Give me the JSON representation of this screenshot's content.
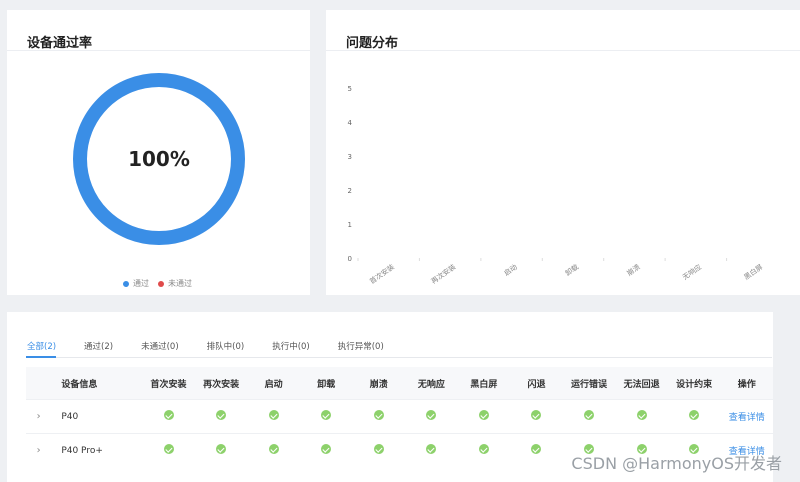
{
  "pass_rate": {
    "title": "设备通过率",
    "center_text": "100%",
    "pass_fraction": 1.0,
    "legend": [
      {
        "label": "通过",
        "color": "#3a8ee6"
      },
      {
        "label": "未通过",
        "color": "#e04b4b"
      }
    ]
  },
  "distribution": {
    "title": "问题分布"
  },
  "chart_data": {
    "type": "bar",
    "categories": [
      "首次安装",
      "再次安装",
      "启动",
      "卸载",
      "崩溃",
      "无响应",
      "黑白屏"
    ],
    "values": [
      0,
      0,
      0,
      0,
      0,
      0,
      0
    ],
    "ylim": [
      0,
      5
    ],
    "yticks": [
      "0",
      "1",
      "2",
      "3",
      "4",
      "5"
    ],
    "title": "",
    "xlabel": "",
    "ylabel": ""
  },
  "tabs": [
    "全部(2)",
    "通过(2)",
    "未通过(0)",
    "排队中(0)",
    "执行中(0)",
    "执行异常(0)"
  ],
  "table": {
    "columns": [
      "设备信息",
      "首次安装",
      "再次安装",
      "启动",
      "卸载",
      "崩溃",
      "无响应",
      "黑白屏",
      "闪退",
      "运行错误",
      "无法回退",
      "设计约束",
      "操作"
    ],
    "rows": [
      {
        "device": "P40",
        "action": "查看详情"
      },
      {
        "device": "P40 Pro+",
        "action": "查看详情"
      }
    ]
  },
  "watermark": "CSDN @HarmonyOS开发者",
  "colors": {
    "accent": "#3a8ee6",
    "pass": "#67c23a"
  }
}
